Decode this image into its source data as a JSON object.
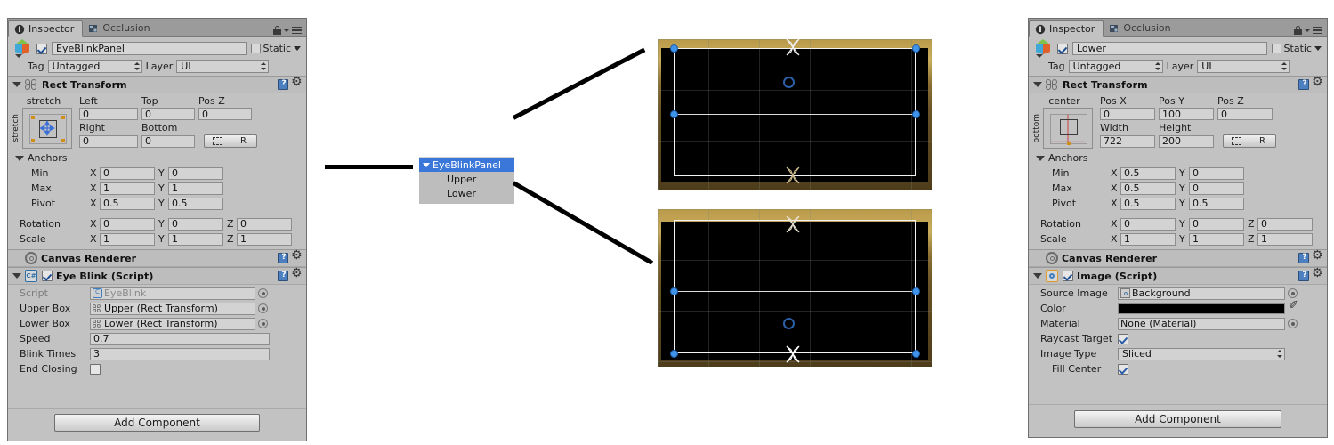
{
  "left_inspector": {
    "tabs": [
      {
        "label": "Inspector",
        "icon": "info-icon",
        "active": true
      },
      {
        "label": "Occlusion",
        "icon": "occlusion-icon",
        "active": false
      }
    ],
    "lock_icon": "lock-icon",
    "menu_icon": "hamburger-menu-icon",
    "object": {
      "name": "EyeBlinkPanel",
      "enabled": true,
      "static_label": "Static",
      "static_checked": false,
      "tag_label": "Tag",
      "tag_value": "Untagged",
      "layer_label": "Layer",
      "layer_value": "UI"
    },
    "rect_transform": {
      "title": "Rect Transform",
      "anchor_preset_top": "stretch",
      "anchor_preset_side": "stretch",
      "headers": [
        "Left",
        "Top",
        "Pos Z"
      ],
      "values": [
        "0",
        "0",
        "0"
      ],
      "headers2": [
        "Right",
        "Bottom"
      ],
      "values2": [
        "0",
        "0"
      ],
      "blueprint_button": "blueprint-mode-button",
      "raw_button": "R",
      "anchors_label": "Anchors",
      "min_label": "Min",
      "min_x": "0",
      "min_y": "0",
      "max_label": "Max",
      "max_x": "1",
      "max_y": "1",
      "pivot_label": "Pivot",
      "pivot_x": "0.5",
      "pivot_y": "0.5",
      "rotation_label": "Rotation",
      "rot_x": "0",
      "rot_y": "0",
      "rot_z": "0",
      "scale_label": "Scale",
      "scale_x": "1",
      "scale_y": "1",
      "scale_z": "1"
    },
    "canvas_renderer": {
      "title": "Canvas Renderer"
    },
    "eye_blink": {
      "title": "Eye Blink (Script)",
      "enabled": true,
      "rows": [
        {
          "label": "Script",
          "value": "EyeBlink",
          "type": "object",
          "dim": true,
          "icon": "cs-script-icon"
        },
        {
          "label": "Upper Box",
          "value": "Upper (Rect Transform)",
          "type": "object",
          "dim": false,
          "icon": "rect-transform-icon"
        },
        {
          "label": "Lower Box",
          "value": "Lower (Rect Transform)",
          "type": "object",
          "dim": false,
          "icon": "rect-transform-icon"
        },
        {
          "label": "Speed",
          "value": "0.7",
          "type": "text"
        },
        {
          "label": "Blink Times",
          "value": "3",
          "type": "text"
        },
        {
          "label": "End Closing",
          "value": "",
          "type": "checkbox",
          "checked": false
        }
      ]
    },
    "add_component_label": "Add Component"
  },
  "right_inspector": {
    "tabs": [
      {
        "label": "Inspector",
        "icon": "info-icon",
        "active": true
      },
      {
        "label": "Occlusion",
        "icon": "occlusion-icon",
        "active": false
      }
    ],
    "object": {
      "name": "Lower",
      "enabled": true,
      "static_label": "Static",
      "static_checked": false,
      "tag_label": "Tag",
      "tag_value": "Untagged",
      "layer_label": "Layer",
      "layer_value": "UI"
    },
    "rect_transform": {
      "title": "Rect Transform",
      "anchor_preset_top": "center",
      "anchor_preset_side": "bottom",
      "headers": [
        "Pos X",
        "Pos Y",
        "Pos Z"
      ],
      "values": [
        "0",
        "100",
        "0"
      ],
      "headers2": [
        "Width",
        "Height"
      ],
      "values2": [
        "722",
        "200"
      ],
      "raw_button": "R",
      "anchors_label": "Anchors",
      "min_label": "Min",
      "min_x": "0.5",
      "min_y": "0",
      "max_label": "Max",
      "max_x": "0.5",
      "max_y": "0",
      "pivot_label": "Pivot",
      "pivot_x": "0.5",
      "pivot_y": "0.5",
      "rotation_label": "Rotation",
      "rot_x": "0",
      "rot_y": "0",
      "rot_z": "0",
      "scale_label": "Scale",
      "scale_x": "1",
      "scale_y": "1",
      "scale_z": "1"
    },
    "canvas_renderer": {
      "title": "Canvas Renderer"
    },
    "image": {
      "title": "Image (Script)",
      "enabled": true,
      "rows": [
        {
          "label": "Source Image",
          "value": "Background",
          "type": "object",
          "icon": "sprite-icon"
        },
        {
          "label": "Color",
          "value": "#000000",
          "type": "color"
        },
        {
          "label": "Material",
          "value": "None (Material)",
          "type": "object",
          "icon": "none-icon"
        },
        {
          "label": "Raycast Target",
          "value": "",
          "type": "checkbox",
          "checked": true
        },
        {
          "label": "Image Type",
          "value": "Sliced",
          "type": "dropdown"
        },
        {
          "label": "Fill Center",
          "value": "",
          "type": "checkbox",
          "checked": true,
          "indent": true
        }
      ]
    },
    "add_component_label": "Add Component"
  },
  "hierarchy": {
    "items": [
      {
        "label": "EyeBlinkPanel",
        "selected": true,
        "foldout": true
      },
      {
        "label": "Upper",
        "selected": false,
        "foldout": false
      },
      {
        "label": "Lower",
        "selected": false,
        "foldout": false
      }
    ],
    "selection_color": "#3a77d8"
  },
  "scene_upper": {
    "name": "upper-box-scene-view",
    "pivot_label": "pivot-handle",
    "handles": 4
  },
  "scene_lower": {
    "name": "lower-box-scene-view",
    "pivot_label": "pivot-handle",
    "handles": 4
  },
  "connectors": {
    "left": "pointer-line-to-hierarchy",
    "upper": "arrow-to-upper-scene",
    "lower": "arrow-to-lower-scene"
  }
}
